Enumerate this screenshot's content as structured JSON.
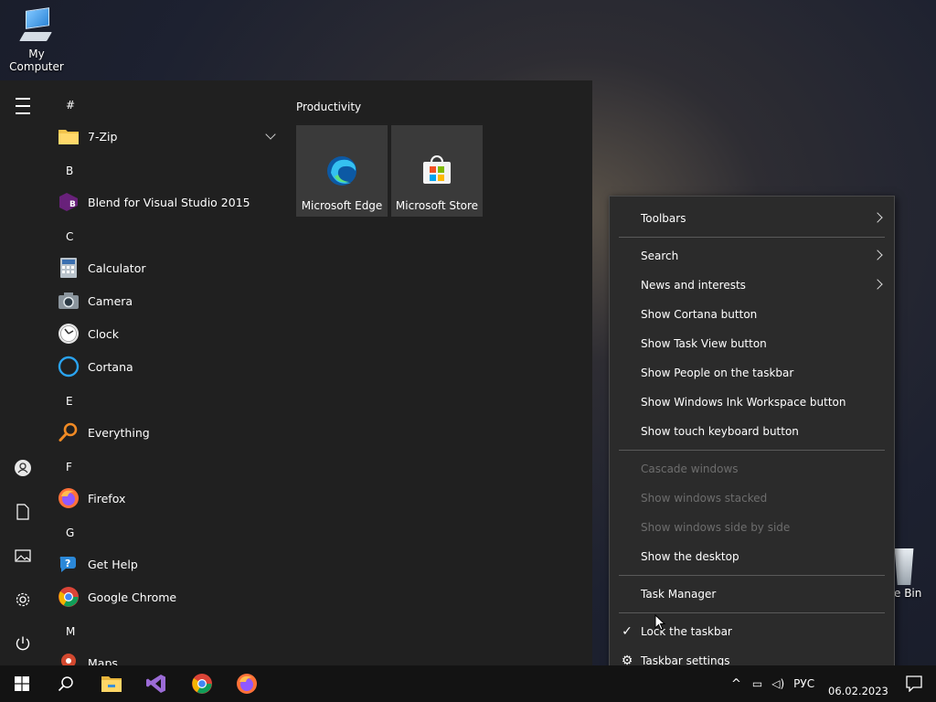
{
  "desktop": {
    "my_computer_label": "My Computer",
    "recycle_bin_label_partial": "e Bin"
  },
  "start_menu": {
    "sections": [
      {
        "letter": "#",
        "apps": [
          {
            "name": "7-Zip",
            "icon": "folder-icon",
            "expandable": true
          }
        ]
      },
      {
        "letter": "B",
        "apps": [
          {
            "name": "Blend for Visual Studio 2015",
            "icon": "blend-icon"
          }
        ]
      },
      {
        "letter": "C",
        "apps": [
          {
            "name": "Calculator",
            "icon": "calculator-icon"
          },
          {
            "name": "Camera",
            "icon": "camera-icon"
          },
          {
            "name": "Clock",
            "icon": "clock-icon"
          },
          {
            "name": "Cortana",
            "icon": "cortana-icon"
          }
        ]
      },
      {
        "letter": "E",
        "apps": [
          {
            "name": "Everything",
            "icon": "search-magnifier-icon"
          }
        ]
      },
      {
        "letter": "F",
        "apps": [
          {
            "name": "Firefox",
            "icon": "firefox-icon"
          }
        ]
      },
      {
        "letter": "G",
        "apps": [
          {
            "name": "Get Help",
            "icon": "help-icon"
          },
          {
            "name": "Google Chrome",
            "icon": "chrome-icon"
          }
        ]
      },
      {
        "letter": "M",
        "apps": [
          {
            "name": "Maps",
            "icon": "maps-icon"
          }
        ]
      }
    ],
    "tile_group_title": "Productivity",
    "tiles": [
      {
        "label": "Microsoft Edge",
        "icon": "edge-icon"
      },
      {
        "label": "Microsoft Store",
        "icon": "store-icon"
      }
    ]
  },
  "context_menu": {
    "items": [
      {
        "label": "Toolbars",
        "submenu": true,
        "disabled": false
      },
      {
        "label": "Search",
        "submenu": true,
        "disabled": false
      },
      {
        "label": "News and interests",
        "submenu": true,
        "disabled": false
      },
      {
        "label": "Show Cortana button",
        "disabled": false
      },
      {
        "label": "Show Task View button",
        "disabled": false
      },
      {
        "label": "Show People on the taskbar",
        "disabled": false
      },
      {
        "label": "Show Windows Ink Workspace button",
        "disabled": false
      },
      {
        "label": "Show touch keyboard button",
        "disabled": false
      },
      {
        "label": "Cascade windows",
        "disabled": true
      },
      {
        "label": "Show windows stacked",
        "disabled": true
      },
      {
        "label": "Show windows side by side",
        "disabled": true
      },
      {
        "label": "Show the desktop",
        "disabled": false
      },
      {
        "label": "Task Manager",
        "disabled": false
      },
      {
        "label": "Lock the taskbar",
        "checked": true,
        "disabled": false
      },
      {
        "label": "Taskbar settings",
        "icon": "gear-icon",
        "disabled": false
      }
    ]
  },
  "taskbar": {
    "pinned": [
      "windows-start-icon",
      "search-icon",
      "file-explorer-icon",
      "visual-studio-icon",
      "chrome-icon",
      "firefox-icon"
    ],
    "tray_lang": "РУС",
    "date": "06.02.2023"
  },
  "colors": {
    "menu_bg": "#202020",
    "tile_bg": "#3a3a3a",
    "context_bg": "#2b2b2b",
    "disabled_text": "#6d6d6d",
    "taskbar_bg": "#131313"
  }
}
